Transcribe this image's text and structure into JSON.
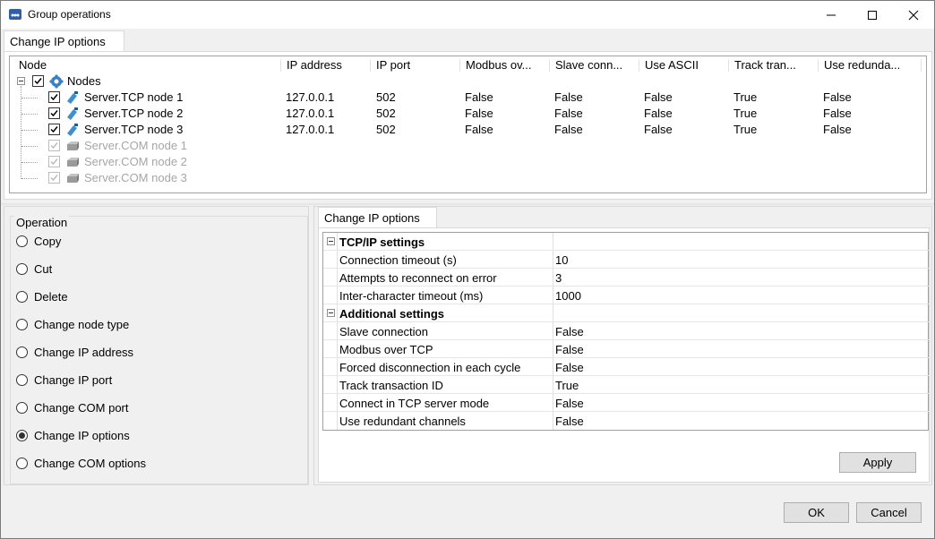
{
  "window": {
    "title": "Group operations",
    "icons": [
      "app-icon",
      "minimize-icon",
      "maximize-icon",
      "close-icon"
    ]
  },
  "top_tab": {
    "label": "Change IP options"
  },
  "tree": {
    "columns": [
      "Node",
      "IP address",
      "IP port",
      "Modbus ov...",
      "Slave conn...",
      "Use ASCII",
      "Track tran...",
      "Use redunda..."
    ],
    "root_label": "Nodes",
    "rows": [
      {
        "name": "Server.TCP node 1",
        "ip": "127.0.0.1",
        "port": "502",
        "modbus": "False",
        "slave": "False",
        "ascii": "False",
        "track": "True",
        "redundant": "False",
        "enabled": true
      },
      {
        "name": "Server.TCP node 2",
        "ip": "127.0.0.1",
        "port": "502",
        "modbus": "False",
        "slave": "False",
        "ascii": "False",
        "track": "True",
        "redundant": "False",
        "enabled": true
      },
      {
        "name": "Server.TCP node 3",
        "ip": "127.0.0.1",
        "port": "502",
        "modbus": "False",
        "slave": "False",
        "ascii": "False",
        "track": "True",
        "redundant": "False",
        "enabled": true
      },
      {
        "name": "Server.COM node 1",
        "enabled": false
      },
      {
        "name": "Server.COM node 2",
        "enabled": false
      },
      {
        "name": "Server.COM node 3",
        "enabled": false
      }
    ]
  },
  "operation": {
    "title": "Operation",
    "options": [
      "Copy",
      "Cut",
      "Delete",
      "Change node type",
      "Change IP address",
      "Change IP port",
      "Change COM port",
      "Change IP options",
      "Change COM options"
    ],
    "selected": "Change IP options"
  },
  "details": {
    "tab_label": "Change IP options",
    "categories": [
      {
        "label": "TCP/IP settings",
        "props": [
          {
            "name": "Connection timeout (s)",
            "value": "10"
          },
          {
            "name": "Attempts to reconnect on error",
            "value": "3"
          },
          {
            "name": "Inter-character timeout (ms)",
            "value": "1000"
          }
        ]
      },
      {
        "label": "Additional settings",
        "props": [
          {
            "name": "Slave connection",
            "value": "False"
          },
          {
            "name": "Modbus over TCP",
            "value": "False"
          },
          {
            "name": "Forced disconnection in each cycle",
            "value": "False"
          },
          {
            "name": "Track transaction ID",
            "value": "True"
          },
          {
            "name": "Connect in TCP server mode",
            "value": "False"
          },
          {
            "name": "Use redundant channels",
            "value": "False"
          }
        ]
      }
    ],
    "apply_label": "Apply"
  },
  "footer": {
    "ok_label": "OK",
    "cancel_label": "Cancel"
  }
}
